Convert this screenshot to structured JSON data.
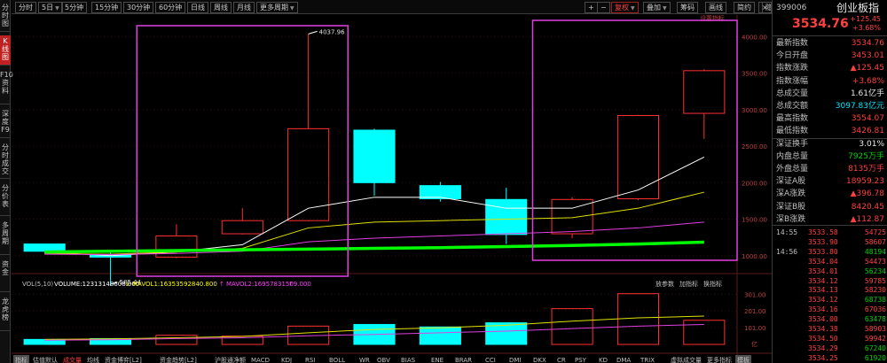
{
  "left_tabs": [
    {
      "label": "分时图",
      "active": false
    },
    {
      "label": "K线图",
      "active": true
    },
    {
      "label": "F10资料",
      "active": false
    },
    {
      "label": "深度F9",
      "active": false
    },
    {
      "label": "分时成交",
      "active": false
    },
    {
      "label": "分价表",
      "active": false
    },
    {
      "label": "多周期",
      "active": false
    },
    {
      "label": "资金",
      "active": false
    },
    {
      "label": "龙虎榜",
      "active": false
    }
  ],
  "toolbar": {
    "periods": [
      "分时",
      "5日",
      "5分钟",
      "15分钟",
      "30分钟",
      "60分钟",
      "日线",
      "周线",
      "月线",
      "更多周期"
    ],
    "right_buttons": [
      "叠加",
      "筹码",
      "画线",
      "简约",
      "隐藏"
    ],
    "zoom_in": "+",
    "zoom_out": "−",
    "restore": "复权",
    "settings": "设置指标",
    "close": "×"
  },
  "price_axis": [
    "4000.00",
    "3500.00",
    "3000.00",
    "2500.00",
    "2000.00",
    "1500.00",
    "1000.00"
  ],
  "annotations": {
    "high": "4037.96",
    "low": "585.44"
  },
  "indicator_bar": {
    "title": "VOL(5,10)",
    "volume": "VOLUME:12313148608.000",
    "mavol1": "MAVOL1:16353592840.800",
    "mavol2": "MAVOL2:16957831509.000",
    "buttons": [
      "放参数",
      "加指标",
      "换指标"
    ]
  },
  "volume_axis": [
    "301.00",
    "201.00",
    "101.00",
    "亿"
  ],
  "bottom_tabs": [
    "指标",
    "估值默认",
    "成交量",
    "均线",
    "资金博弈[L2]",
    "资金趋势[L2]",
    "沪股通净额",
    "MACD",
    "KDJ",
    "RSI",
    "BOLL",
    "WR",
    "OBV",
    "BIAS",
    "ENE",
    "BRAR",
    "CCI",
    "DMI",
    "DKX",
    "CR",
    "PSY",
    "KD",
    "DMA",
    "TRIX",
    "虚拟成交量",
    "更多指标",
    "模板"
  ],
  "chart_data": {
    "type": "candlestick",
    "price_range": [
      900,
      4200
    ],
    "candles": [
      {
        "open": 1060,
        "close": 1160,
        "high": 1165,
        "low": 1055,
        "color": "cyan"
      },
      {
        "open": 1020,
        "close": 980,
        "high": 1040,
        "low": 585.44,
        "color": "cyan"
      },
      {
        "open": 1270,
        "close": 980,
        "high": 1430,
        "low": 965,
        "color": "red"
      },
      {
        "open": 1300,
        "close": 1480,
        "high": 1650,
        "low": 1290,
        "color": "red"
      },
      {
        "open": 1480,
        "close": 2740,
        "high": 4037.96,
        "low": 1470,
        "color": "red"
      },
      {
        "open": 2720,
        "close": 2000,
        "high": 2740,
        "low": 1820,
        "color": "cyan"
      },
      {
        "open": 1960,
        "close": 1780,
        "high": 2010,
        "low": 1740,
        "color": "cyan"
      },
      {
        "open": 1770,
        "close": 1290,
        "high": 1930,
        "low": 1160,
        "color": "cyan"
      },
      {
        "open": 1300,
        "close": 1770,
        "high": 1800,
        "low": 1240,
        "color": "red"
      },
      {
        "open": 1780,
        "close": 2920,
        "high": 2930,
        "low": 1760,
        "color": "red"
      },
      {
        "open": 2950,
        "close": 3534.76,
        "high": 3554.07,
        "low": 2600,
        "color": "red"
      }
    ],
    "ma_lines": [
      {
        "name": "MA5",
        "color": "#ffffff",
        "values": [
          1050,
          1000,
          1050,
          1150,
          1650,
          1800,
          1800,
          1650,
          1650,
          1900,
          2350
        ]
      },
      {
        "name": "MA10",
        "color": "#e0e000",
        "values": [
          1030,
          1020,
          1050,
          1100,
          1380,
          1460,
          1480,
          1500,
          1520,
          1650,
          1870
        ]
      },
      {
        "name": "MA20",
        "color": "#e040e0",
        "values": [
          1020,
          1015,
          1030,
          1060,
          1190,
          1240,
          1270,
          1300,
          1330,
          1380,
          1460
        ]
      },
      {
        "name": "MA60",
        "color": "#00ff00",
        "values": [
          1050,
          1060,
          1070,
          1080,
          1090,
          1100,
          1110,
          1125,
          1140,
          1160,
          1185
        ]
      }
    ],
    "volume": {
      "range": [
        0,
        330
      ],
      "bars": [
        {
          "value": 30,
          "color": "cyan"
        },
        {
          "value": 35,
          "color": "cyan"
        },
        {
          "value": 55,
          "color": "red"
        },
        {
          "value": 50,
          "color": "red"
        },
        {
          "value": 110,
          "color": "red"
        },
        {
          "value": 120,
          "color": "cyan"
        },
        {
          "value": 105,
          "color": "cyan"
        },
        {
          "value": 130,
          "color": "cyan"
        },
        {
          "value": 215,
          "color": "red"
        },
        {
          "value": 305,
          "color": "red"
        },
        {
          "value": 145,
          "color": "red"
        }
      ],
      "mavol1": [
        30,
        33,
        40,
        48,
        70,
        90,
        100,
        115,
        140,
        160,
        170
      ],
      "mavol2": [
        25,
        28,
        35,
        40,
        52,
        60,
        70,
        80,
        95,
        110,
        120
      ]
    }
  },
  "quote": {
    "code": "399006",
    "name": "创业板指",
    "price": "3534.76",
    "change": "+125.45",
    "change_pct": "+3.68%",
    "rows": [
      {
        "label": "最新指数",
        "value": "3534.76",
        "cls": "red"
      },
      {
        "label": "今日开盘",
        "value": "3453.01",
        "cls": "red"
      },
      {
        "label": "指数涨跌",
        "value": "▲125.45",
        "cls": "red"
      },
      {
        "label": "指数涨幅",
        "value": "+3.68%",
        "cls": "red"
      },
      {
        "label": "总成交量",
        "value": "1.61亿手",
        "cls": "white"
      },
      {
        "label": "总成交额",
        "value": "3097.83亿元",
        "cls": "cyan"
      },
      {
        "label": "最高指数",
        "value": "3554.07",
        "cls": "red"
      },
      {
        "label": "最低指数",
        "value": "3426.81",
        "cls": "red"
      },
      {
        "label": "深证换手",
        "value": "3.01%",
        "cls": "white"
      },
      {
        "label": "内盘总量",
        "value": "7925万手",
        "cls": "green"
      },
      {
        "label": "外盘总量",
        "value": "8135万手",
        "cls": "red"
      },
      {
        "label": "深证A股",
        "value": "18959.23",
        "cls": "red"
      },
      {
        "label": "深A涨跌",
        "value": "▲396.78",
        "cls": "red"
      },
      {
        "label": "深证B股",
        "value": "8420.45",
        "cls": "red"
      },
      {
        "label": "深B涨跌",
        "value": "▲112.87",
        "cls": "red"
      }
    ],
    "ticks": [
      {
        "time": "14:55",
        "price": "3533.58",
        "vol": "54725",
        "vcls": "red"
      },
      {
        "time": "",
        "price": "3533.90",
        "vol": "58607",
        "vcls": "red"
      },
      {
        "time": "14:56",
        "price": "3533.80",
        "vol": "48194",
        "vcls": "green"
      },
      {
        "time": "",
        "price": "3534.04",
        "vol": "54473",
        "vcls": "red"
      },
      {
        "time": "",
        "price": "3534.01",
        "vol": "56234",
        "vcls": "green"
      },
      {
        "time": "",
        "price": "3534.12",
        "vol": "59785",
        "vcls": "red"
      },
      {
        "time": "",
        "price": "3534.13",
        "vol": "58230",
        "vcls": "red"
      },
      {
        "time": "",
        "price": "3534.12",
        "vol": "68738",
        "vcls": "green"
      },
      {
        "time": "",
        "price": "3534.16",
        "vol": "67036",
        "vcls": "red"
      },
      {
        "time": "",
        "price": "3534.00",
        "vol": "63478",
        "vcls": "green"
      },
      {
        "time": "",
        "price": "3534.38",
        "vol": "58903",
        "vcls": "red"
      },
      {
        "time": "",
        "price": "3534.50",
        "vol": "59942",
        "vcls": "red"
      },
      {
        "time": "",
        "price": "3534.29",
        "vol": "67240",
        "vcls": "green"
      },
      {
        "time": "",
        "price": "3534.25",
        "vol": "61920",
        "vcls": "green"
      }
    ]
  }
}
